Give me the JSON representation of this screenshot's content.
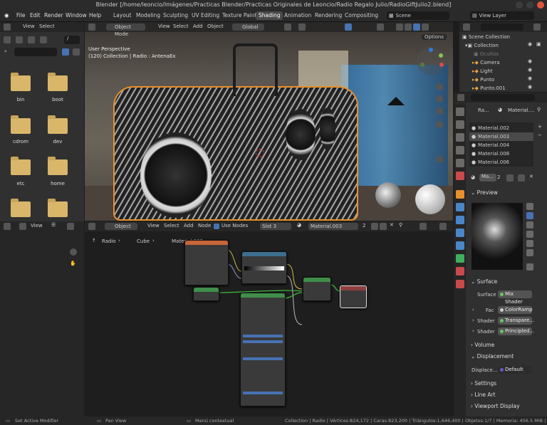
{
  "window_title": "Blender [/home/leoncio/Imágenes/Practicas Blender/Practicas Originales de Leoncio/Radio Regalo Julio/RadioGiftJulio2.blend]",
  "menu": [
    "File",
    "Edit",
    "Render",
    "Window",
    "Help"
  ],
  "workspaces": [
    "Layout",
    "Modeling",
    "Sculpting",
    "UV Editing",
    "Texture Paint",
    "Shading",
    "Animation",
    "Rendering",
    "Compositing"
  ],
  "active_workspace": "Shading",
  "scene_label": "Scene",
  "view_layer_label": "View Layer",
  "file_browser": {
    "view": "View",
    "select": "Select",
    "path": "/",
    "folders": [
      "bin",
      "boot",
      "cdrom",
      "dev",
      "etc",
      "home",
      "",
      ""
    ]
  },
  "viewport": {
    "mode": "Object Mode",
    "menus": [
      "View",
      "Select",
      "Add",
      "Object"
    ],
    "transform": "Global",
    "options": "Options",
    "perspective": "User Perspective",
    "info": "(120) Collection | Radio : AntenaEx"
  },
  "outliner": {
    "root": "Scene Collection",
    "items": [
      {
        "label": "Collection",
        "color": "#cccccc"
      },
      {
        "label": "Ocultos",
        "color": "#777777"
      },
      {
        "label": "Camera",
        "color": "#dddddd"
      },
      {
        "label": "Light",
        "color": "#dddddd"
      },
      {
        "label": "Punto",
        "color": "#dddddd"
      },
      {
        "label": "Punto.001",
        "color": "#dddddd"
      }
    ]
  },
  "properties": {
    "crumb_obj": "Ra...",
    "crumb_mat": "Material....",
    "materials": [
      "Material.002",
      "Material.003",
      "Material.004",
      "Material.008",
      "Material.006"
    ],
    "selected_material": "Material.003",
    "mat_name": "Ma...",
    "mat_users": "2",
    "preview": "Preview",
    "surface": "Surface",
    "surface_label": "Surface",
    "surface_value": "Mix Shader",
    "fac_label": "Fac",
    "fac_value": "ColorRamp",
    "shader1_label": "Shader",
    "shader1_value": "Transpare...",
    "shader2_label": "Shader",
    "shader2_value": "Principled...",
    "volume": "Volume",
    "displacement": "Displacement",
    "disp_label": "Displace...",
    "disp_value": "Default",
    "settings": "Settings",
    "line_art": "Line Art",
    "viewport_display": "Viewport Display"
  },
  "image_editor": {
    "view": "View"
  },
  "node_editor": {
    "object": "Object",
    "menus": [
      "View",
      "Select",
      "Add",
      "Node"
    ],
    "use_nodes": "Use Nodes",
    "slot": "Slot 3",
    "material": "Material.003",
    "users": "2",
    "crumbs": [
      "Radio",
      "Cube",
      "Material.003"
    ]
  },
  "status": {
    "left": "Set Active Modifier",
    "mid1": "Pan View",
    "mid2": "Menú contextual",
    "right": "Collection | Radio | Vértices:824,172 | Caras:823,200 | Triángulos:1,646,400 | Objetos:1/7 | Memoria: 456.5 MiB | VRAM: 0.9/"
  }
}
